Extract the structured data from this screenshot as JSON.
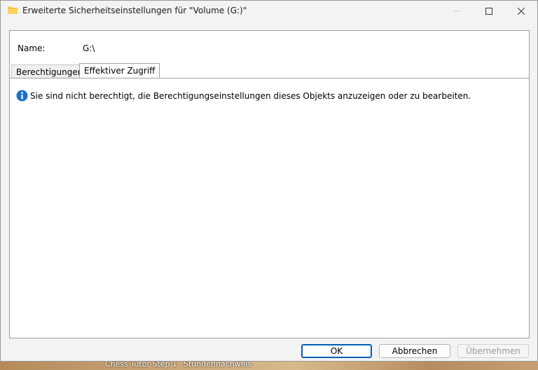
{
  "window": {
    "title": "Erweiterte Sicherheitseinstellungen für \"Volume (G:)\"",
    "icon": "folder-icon"
  },
  "object": {
    "name_label": "Name:",
    "name_value": "G:\\"
  },
  "tabs": [
    {
      "label": "Berechtigungen",
      "active": false
    },
    {
      "label": "Effektiver Zugriff",
      "active": true
    }
  ],
  "content": {
    "message": "Sie sind nicht berechtigt, die Berechtigungseinstellungen dieses Objekts anzuzeigen oder zu bearbeiten.",
    "icon": "info-icon"
  },
  "buttons": {
    "ok": "OK",
    "cancel": "Abbrechen",
    "apply": "Übernehmen"
  },
  "taskbar": {
    "items": [
      "Chess Tutor Step 1",
      "Stundennachweis"
    ]
  },
  "colors": {
    "accent": "#005fb8",
    "info_blue": "#1a6fc7",
    "folder_yellow": "#f7c744"
  }
}
